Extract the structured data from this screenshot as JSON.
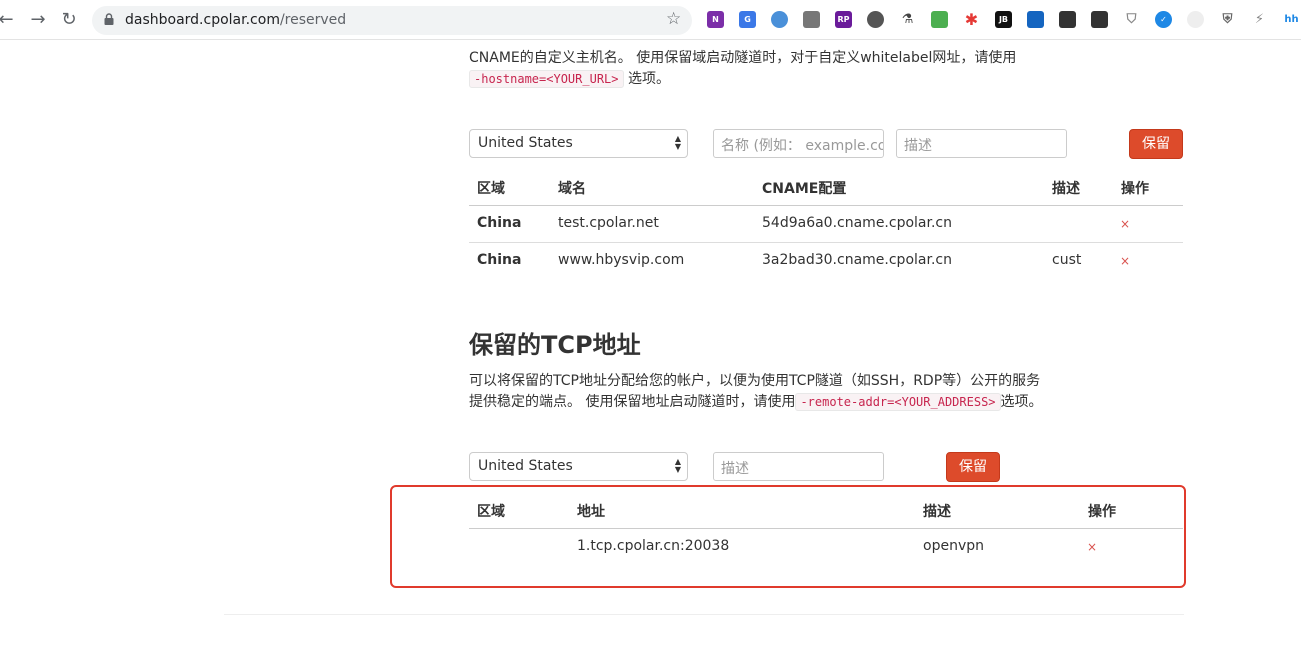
{
  "browser": {
    "url_host": "dashboard.cpolar.com",
    "url_path": "/reserved",
    "back_icon": "back-arrow-icon",
    "forward_icon": "forward-arrow-icon",
    "reload_icon": "reload-icon",
    "lock_icon": "lock-icon",
    "bookmark_icon": "star-icon"
  },
  "intro": {
    "line2": "CNAME的自定义主机名。 使用保留域启动隧道时，对于自定义whitelabel网址，请使用",
    "code": "-hostname=<YOUR_URL>",
    "tail": "选项。"
  },
  "domain_form": {
    "region_selected": "United States",
    "domain_placeholder": "名称 (例如： example.com)",
    "desc_placeholder": "描述",
    "reserve_label": "保留"
  },
  "domain_table": {
    "headers": [
      "区域",
      "域名",
      "CNAME配置",
      "描述",
      "操作"
    ],
    "rows": [
      {
        "region": "China",
        "domain": "test.cpolar.net",
        "cname": "54d9a6a0.cname.cpolar.cn",
        "desc": "",
        "action": "×"
      },
      {
        "region": "China",
        "domain": "www.hbysvip.com",
        "cname": "3a2bad30.cname.cpolar.cn",
        "desc": "cust",
        "action": "×"
      }
    ]
  },
  "tcp_section": {
    "title": "保留的TCP地址",
    "desc_line1": "可以将保留的TCP地址分配给您的帐户，以便为使用TCP隧道（如SSH，RDP等）公开的服务",
    "desc_line2_pre": "提供稳定的端点。 使用保留地址启动隧道时，请使用",
    "desc_code": "-remote-addr=<YOUR_ADDRESS>",
    "desc_line2_post": "选项。"
  },
  "tcp_form": {
    "region_selected": "United States",
    "desc_placeholder": "描述",
    "reserve_label": "保留"
  },
  "tcp_table": {
    "headers": [
      "区域",
      "地址",
      "描述",
      "操作"
    ],
    "rows": [
      {
        "region": "",
        "address": "1.tcp.cpolar.cn:20038",
        "desc": "openvpn",
        "action": "×"
      }
    ]
  },
  "colors": {
    "accent": "#dd4b2b",
    "highlight": "#e03a2c",
    "delete": "#d9534f",
    "code": "#c7254e"
  }
}
